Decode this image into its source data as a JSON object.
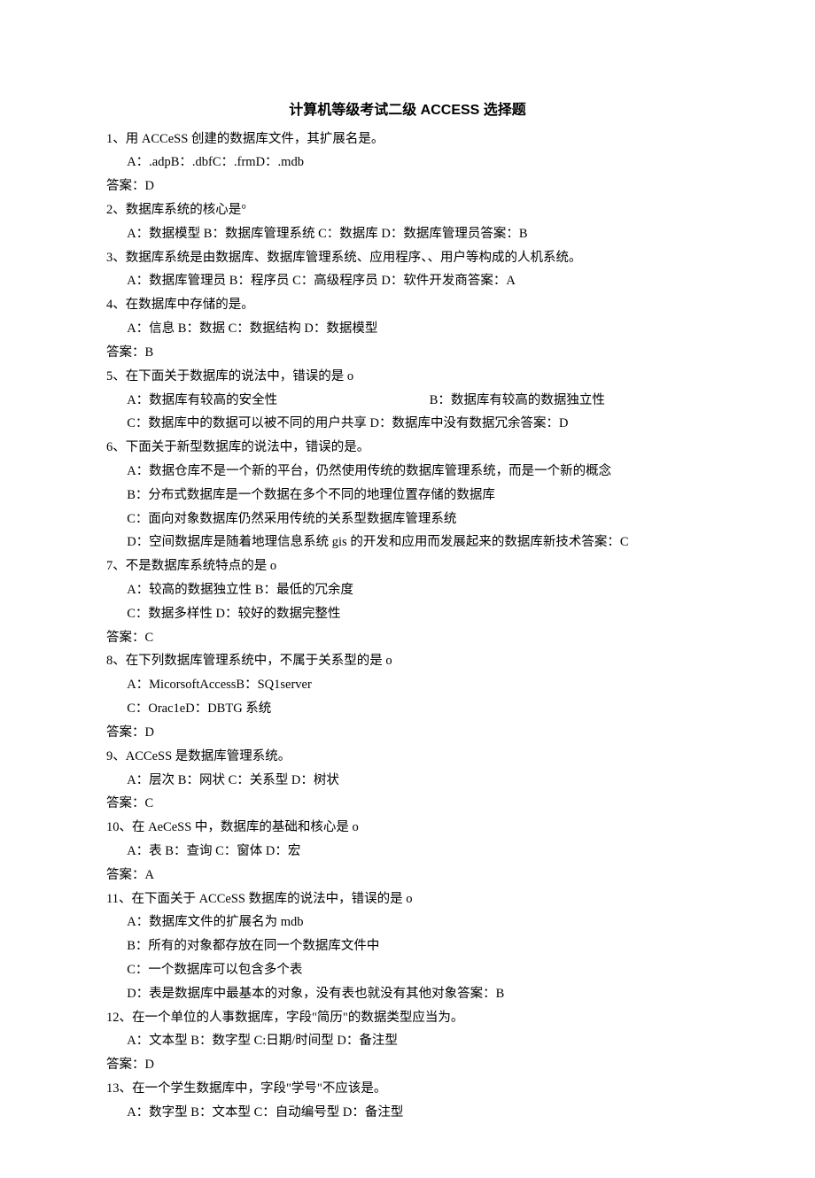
{
  "title": "计算机等级考试二级 ACCESS 选择题",
  "q1": {
    "stem": "1、用 ACCeSS 创建的数据库文件，其扩展名是。",
    "opts": "A：.adpB：.dbfC：.frmD：.mdb",
    "ans": "答案：D"
  },
  "q2": {
    "stem": "2、数据库系统的核心是°",
    "opts": "A：数据模型 B：数据库管理系统 C：数据库 D：数据库管理员答案：B"
  },
  "q3": {
    "stem": "3、数据库系统是由数据库、数据库管理系统、应用程序、、用户等构成的人机系统。",
    "opts": "A：数据库管理员 B：程序员 C：高级程序员 D：软件开发商答案：A"
  },
  "q4": {
    "stem": "4、在数据库中存储的是。",
    "opts": "A：信息 B：数据 C：数据结构 D：数据模型",
    "ans": "答案：B"
  },
  "q5": {
    "stem": "5、在下面关于数据库的说法中，错误的是 o",
    "optA": "A：数据库有较高的安全性",
    "optB": "B：数据库有较高的数据独立性",
    "optCD": "C：数据库中的数据可以被不同的用户共享 D：数据库中没有数据冗余答案：D"
  },
  "q6": {
    "stem": "6、下面关于新型数据库的说法中，错误的是。",
    "optA": "A：数据仓库不是一个新的平台，仍然使用传统的数据库管理系统，而是一个新的概念",
    "optB": "B：分布式数据库是一个数据在多个不同的地理位置存储的数据库",
    "optC": "C：面向对象数据库仍然采用传统的关系型数据库管理系统",
    "optD": "D：空间数据库是随着地理信息系统 gis 的开发和应用而发展起来的数据库新技术答案：C"
  },
  "q7": {
    "stem": "7、不是数据库系统特点的是 o",
    "optAB": "A：较高的数据独立性 B：最低的冗余度",
    "optCD": "C：数据多样性 D：较好的数据完整性",
    "ans": "答案：C"
  },
  "q8": {
    "stem": "8、在下列数据库管理系统中，不属于关系型的是 o",
    "optAB": "A：MicorsoftAccessB：SQ1server",
    "optCD": "C：Orac1eD：DBTG 系统",
    "ans": "答案：D"
  },
  "q9": {
    "stem": "9、ACCeSS 是数据库管理系统。",
    "opts": "A：层次 B：网状 C：关系型 D：树状",
    "ans": "答案：C"
  },
  "q10": {
    "stem": "10、在 AeCeSS 中，数据库的基础和核心是 o",
    "opts": "A：表 B：查询 C：窗体 D：宏",
    "ans": "答案：A"
  },
  "q11": {
    "stem": "11、在下面关于 ACCeSS 数据库的说法中，错误的是 o",
    "optA": "A：数据库文件的扩展名为 mdb",
    "optB": "B：所有的对象都存放在同一个数据库文件中",
    "optC": "C：一个数据库可以包含多个表",
    "optD": "D：表是数据库中最基本的对象，没有表也就没有其他对象答案：B"
  },
  "q12": {
    "stem": "12、在一个单位的人事数据库，字段\"简历\"的数据类型应当为。",
    "opts": "A：文本型 B：数字型 C:日期/时间型 D：备注型",
    "ans": "答案：D"
  },
  "q13": {
    "stem": "13、在一个学生数据库中，字段\"学号\"不应该是。",
    "opts": "A：数字型 B：文本型 C：自动编号型 D：备注型"
  }
}
